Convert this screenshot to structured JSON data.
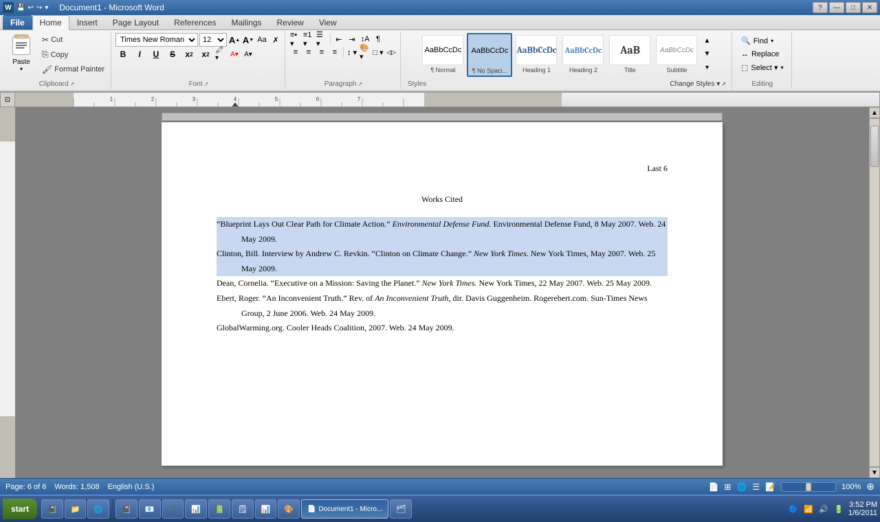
{
  "titleBar": {
    "title": "Document1 - Microsoft Word",
    "quickAccess": [
      "save",
      "undo",
      "redo",
      "customize"
    ],
    "controls": [
      "minimize",
      "maximize",
      "close"
    ]
  },
  "ribbon": {
    "tabs": [
      "File",
      "Home",
      "Insert",
      "Page Layout",
      "References",
      "Mailings",
      "Review",
      "View"
    ],
    "activeTab": "Home",
    "groups": {
      "clipboard": {
        "label": "Clipboard",
        "paste": "Paste",
        "cut": "Cut",
        "copy": "Copy",
        "formatPainter": "Format Painter"
      },
      "font": {
        "label": "Font",
        "fontName": "Times New Rom",
        "fontSize": "12",
        "buttons": [
          "B",
          "I",
          "U",
          "S",
          "x2",
          "x2s"
        ],
        "growFont": "A▲",
        "shrinkFont": "A▼",
        "changeCase": "Aa",
        "clearFormat": "✗"
      },
      "paragraph": {
        "label": "Paragraph",
        "bullets": "≡•",
        "numbering": "≡1",
        "multilevel": "≡☰",
        "increaseIndent": "→",
        "decreaseIndent": "←",
        "sort": "↕A",
        "showHide": "¶",
        "alignLeft": "≡l",
        "alignCenter": "≡c",
        "alignRight": "≡r",
        "justify": "≡j",
        "lineSpacing": "↕",
        "shading": "▲",
        "borders": "□"
      },
      "styles": {
        "label": "Styles",
        "items": [
          {
            "id": "normal",
            "label": "¶ Normal",
            "preview": "Normal"
          },
          {
            "id": "nospace",
            "label": "¶ No Spaci...",
            "preview": "No Spaci...",
            "active": true
          },
          {
            "id": "heading1",
            "label": "Heading 1",
            "preview": "Heading 1"
          },
          {
            "id": "heading2",
            "label": "Heading 2",
            "preview": "Heading 2"
          },
          {
            "id": "title",
            "label": "Title",
            "preview": "Title"
          },
          {
            "id": "subtitle",
            "label": "Subtitle",
            "preview": "Subtitle"
          }
        ],
        "changeStyles": "Change Styles ▾"
      },
      "editing": {
        "label": "Editing",
        "find": "Find",
        "replace": "Replace",
        "select": "Select ▾"
      }
    }
  },
  "document": {
    "pageNumber": "Last 6",
    "title": "Works Cited",
    "citations": [
      {
        "id": 1,
        "text": "\"Blueprint Lays Out Clear Path for Climate Action.\" Environmental Defense Fund. Environmental Defense Fund, 8 May 2007. Web. 24 May 2009.",
        "selected": true
      },
      {
        "id": 2,
        "text": "Clinton, Bill. Interview by Andrew C. Revkin. \"Clinton on Climate Change.\" New York Times. New York Times, May 2007. Web. 25 May 2009.",
        "selected": true
      },
      {
        "id": 3,
        "text": "Dean, Cornelia. \"Executive on a Mission: Saving the Planet.\" New York Times. New York Times, 22 May 2007. Web. 25 May 2009.",
        "selected": false
      },
      {
        "id": 4,
        "text": "Ebert, Roger. \"An Inconvenient Truth.\" Rev. of An Inconvenient Truth, dir. Davis Guggenheim. Rogerebert.com. Sun-Times News Group, 2 June 2006. Web. 24 May 2009.",
        "selected": false
      },
      {
        "id": 5,
        "text": "GlobalWarming.org. Cooler Heads Coalition, 2007. Web. 24 May 2009.",
        "selected": false
      }
    ]
  },
  "statusBar": {
    "page": "Page: 6 of 6",
    "words": "Words: 1,508",
    "language": "English (U.S.)",
    "viewButtons": [
      "print",
      "fullscreen",
      "web",
      "outline",
      "draft"
    ],
    "zoom": "100%"
  },
  "taskbar": {
    "startLabel": "start",
    "time": "3:52 PM",
    "date": "1/6/2011",
    "apps": [
      {
        "id": "onenote",
        "icon": "📓"
      },
      {
        "id": "folder",
        "icon": "📁"
      },
      {
        "id": "media",
        "icon": "🎵"
      },
      {
        "id": "ie",
        "icon": "🌐"
      },
      {
        "id": "notepad",
        "icon": "📝"
      },
      {
        "id": "excel",
        "icon": "📊"
      },
      {
        "id": "outlook",
        "icon": "📧"
      },
      {
        "id": "word",
        "icon": "📄",
        "active": true
      },
      {
        "id": "misc",
        "icon": "🗂"
      },
      {
        "id": "paint",
        "icon": "🎨"
      }
    ]
  },
  "icons": {
    "paste": "📋",
    "cut": "✂",
    "copy": "📄",
    "formatPainter": "🖌",
    "find": "🔍",
    "replace": "↔",
    "select": "⬚"
  }
}
